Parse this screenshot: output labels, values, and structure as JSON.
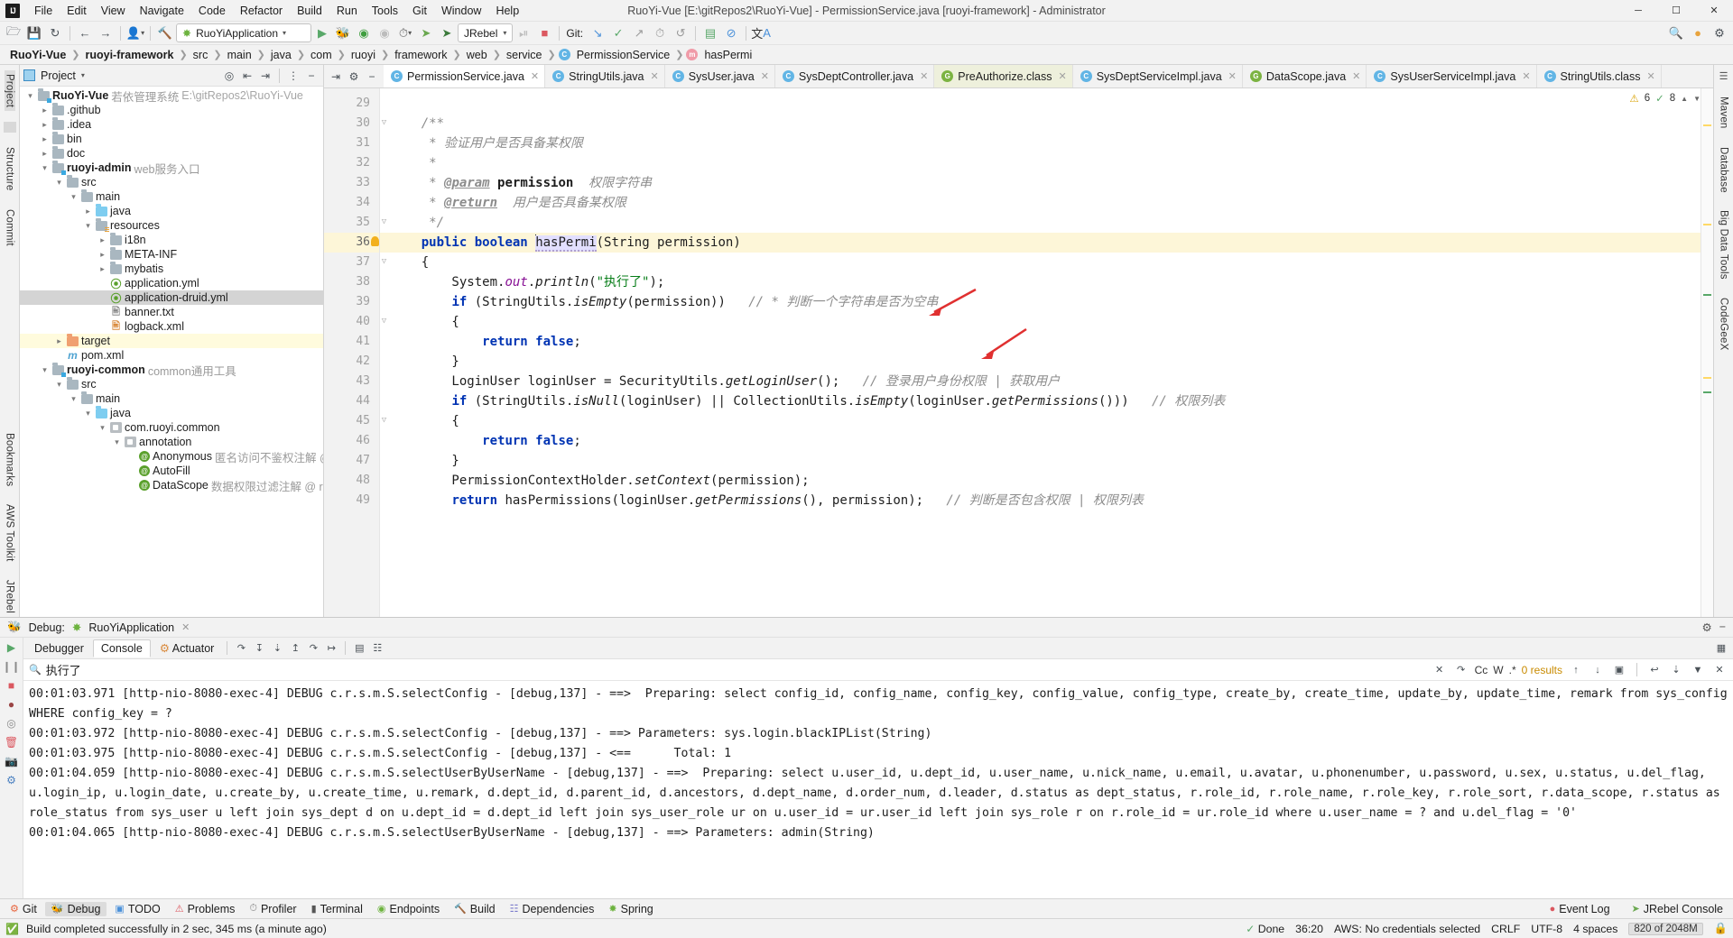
{
  "window": {
    "title": "RuoYi-Vue [E:\\gitRepos2\\RuoYi-Vue] - PermissionService.java [ruoyi-framework] - Administrator",
    "minimize": "─",
    "maximize": "☐",
    "close": "✕"
  },
  "menu": [
    "File",
    "Edit",
    "View",
    "Navigate",
    "Code",
    "Refactor",
    "Build",
    "Run",
    "Tools",
    "Git",
    "Window",
    "Help"
  ],
  "toolbar": {
    "open_icon": "folder-open-icon",
    "save_icon": "save-icon",
    "sync_icon": "sync-icon",
    "back_icon": "←",
    "forward_icon": "→",
    "profile_icon": "user-icon",
    "build_icon": "hammer-icon",
    "run_config": "RuoYiApplication",
    "run_icon": "▶",
    "debug_icon": "bug-icon",
    "run_coverage_icon": "coverage-icon",
    "rerun_icon": "rerun-icon",
    "profiler_icon": "profiler-icon",
    "jrebel_run_icon": "jrebel-run-icon",
    "jrebel_debug_icon": "jrebel-debug-icon",
    "jrebel_label": "JRebel",
    "stop_icon": "stop-icon",
    "git_label": "Git:",
    "git_update_icon": "update-project-icon",
    "git_commit_icon": "commit-icon",
    "git_push_icon": "push-icon",
    "git_history_icon": "history-icon",
    "git_rollback_icon": "rollback-icon",
    "monitor_icon": "monitor-icon",
    "noop_icon": "no-entry-icon",
    "translate_icon": "translate-icon",
    "search_icon": "search-icon",
    "plugin_icon": "plugin-icon",
    "settings_icon": "settings-icon"
  },
  "breadcrumb": [
    {
      "label": "RuoYi-Vue",
      "bold": true,
      "icon": null
    },
    {
      "label": "ruoyi-framework",
      "bold": true,
      "icon": null
    },
    {
      "label": "src",
      "bold": false,
      "icon": null
    },
    {
      "label": "main",
      "bold": false,
      "icon": null
    },
    {
      "label": "java",
      "bold": false,
      "icon": null
    },
    {
      "label": "com",
      "bold": false,
      "icon": null
    },
    {
      "label": "ruoyi",
      "bold": false,
      "icon": null
    },
    {
      "label": "framework",
      "bold": false,
      "icon": null
    },
    {
      "label": "web",
      "bold": false,
      "icon": null
    },
    {
      "label": "service",
      "bold": false,
      "icon": null
    },
    {
      "label": "PermissionService",
      "bold": false,
      "icon": "class"
    },
    {
      "label": "hasPermi",
      "bold": false,
      "icon": "method"
    }
  ],
  "left_rail": [
    "Project",
    "Structure",
    "Commit"
  ],
  "right_rail": [
    "Maven",
    "Database",
    "Big Data Tools",
    "CodeGeeX"
  ],
  "bottom_rail": [
    "Bookmarks",
    "AWS Toolkit",
    "JRebel"
  ],
  "project_panel": {
    "title": "Project",
    "select_icon": "target-icon",
    "expand_icon": "expand-all-icon",
    "collapse_icon": "collapse-all-icon",
    "settings_icon": "gear-icon",
    "hide_icon": "hide-icon",
    "tree": [
      {
        "indent": 0,
        "arrow": "v",
        "icon": "module",
        "name": "RuoYi-Vue",
        "bold": true,
        "desc": "若依管理系统",
        "path": "E:\\gitRepos2\\RuoYi-Vue",
        "state": ""
      },
      {
        "indent": 1,
        "arrow": ">",
        "icon": "folder",
        "name": ".github",
        "bold": false,
        "desc": "",
        "path": "",
        "state": ""
      },
      {
        "indent": 1,
        "arrow": ">",
        "icon": "folder",
        "name": ".idea",
        "bold": false,
        "desc": "",
        "path": "",
        "state": ""
      },
      {
        "indent": 1,
        "arrow": ">",
        "icon": "folder",
        "name": "bin",
        "bold": false,
        "desc": "",
        "path": "",
        "state": ""
      },
      {
        "indent": 1,
        "arrow": ">",
        "icon": "folder",
        "name": "doc",
        "bold": false,
        "desc": "",
        "path": "",
        "state": ""
      },
      {
        "indent": 1,
        "arrow": "v",
        "icon": "module",
        "name": "ruoyi-admin",
        "bold": true,
        "desc": "web服务入口",
        "path": "",
        "state": ""
      },
      {
        "indent": 2,
        "arrow": "v",
        "icon": "folder",
        "name": "src",
        "bold": false,
        "desc": "",
        "path": "",
        "state": ""
      },
      {
        "indent": 3,
        "arrow": "v",
        "icon": "folder",
        "name": "main",
        "bold": false,
        "desc": "",
        "path": "",
        "state": ""
      },
      {
        "indent": 4,
        "arrow": ">",
        "icon": "folder-blue",
        "name": "java",
        "bold": false,
        "desc": "",
        "path": "",
        "state": ""
      },
      {
        "indent": 4,
        "arrow": "v",
        "icon": "folder-res",
        "name": "resources",
        "bold": false,
        "desc": "",
        "path": "",
        "state": ""
      },
      {
        "indent": 5,
        "arrow": ">",
        "icon": "folder",
        "name": "i18n",
        "bold": false,
        "desc": "",
        "path": "",
        "state": ""
      },
      {
        "indent": 5,
        "arrow": ">",
        "icon": "folder",
        "name": "META-INF",
        "bold": false,
        "desc": "",
        "path": "",
        "state": ""
      },
      {
        "indent": 5,
        "arrow": ">",
        "icon": "folder",
        "name": "mybatis",
        "bold": false,
        "desc": "",
        "path": "",
        "state": ""
      },
      {
        "indent": 5,
        "arrow": "",
        "icon": "yml",
        "name": "application.yml",
        "bold": false,
        "desc": "",
        "path": "",
        "state": ""
      },
      {
        "indent": 5,
        "arrow": "",
        "icon": "yml",
        "name": "application-druid.yml",
        "bold": false,
        "desc": "",
        "path": "",
        "state": "sel"
      },
      {
        "indent": 5,
        "arrow": "",
        "icon": "txt",
        "name": "banner.txt",
        "bold": false,
        "desc": "",
        "path": "",
        "state": ""
      },
      {
        "indent": 5,
        "arrow": "",
        "icon": "xml",
        "name": "logback.xml",
        "bold": false,
        "desc": "",
        "path": "",
        "state": ""
      },
      {
        "indent": 2,
        "arrow": ">",
        "icon": "folder-orange",
        "name": "target",
        "bold": false,
        "desc": "",
        "path": "",
        "state": "hl"
      },
      {
        "indent": 2,
        "arrow": "",
        "icon": "maven",
        "name": "pom.xml",
        "bold": false,
        "desc": "",
        "path": "",
        "state": ""
      },
      {
        "indent": 1,
        "arrow": "v",
        "icon": "module",
        "name": "ruoyi-common",
        "bold": true,
        "desc": "common通用工具",
        "path": "",
        "state": ""
      },
      {
        "indent": 2,
        "arrow": "v",
        "icon": "folder",
        "name": "src",
        "bold": false,
        "desc": "",
        "path": "",
        "state": ""
      },
      {
        "indent": 3,
        "arrow": "v",
        "icon": "folder",
        "name": "main",
        "bold": false,
        "desc": "",
        "path": "",
        "state": ""
      },
      {
        "indent": 4,
        "arrow": "v",
        "icon": "folder-blue",
        "name": "java",
        "bold": false,
        "desc": "",
        "path": "",
        "state": ""
      },
      {
        "indent": 5,
        "arrow": "v",
        "icon": "package",
        "name": "com.ruoyi.common",
        "bold": false,
        "desc": "",
        "path": "",
        "state": ""
      },
      {
        "indent": 6,
        "arrow": "v",
        "icon": "package",
        "name": "annotation",
        "bold": false,
        "desc": "",
        "path": "",
        "state": ""
      },
      {
        "indent": 7,
        "arrow": "",
        "icon": "annotation",
        "name": "Anonymous",
        "bold": false,
        "desc": "匿名访问不鉴权注解 @ ruoyi",
        "path": "",
        "state": ""
      },
      {
        "indent": 7,
        "arrow": "",
        "icon": "annotation",
        "name": "AutoFill",
        "bold": false,
        "desc": "",
        "path": "",
        "state": ""
      },
      {
        "indent": 7,
        "arrow": "",
        "icon": "annotation",
        "name": "DataScope",
        "bold": false,
        "desc": "数据权限过滤注解 @ ruoyi",
        "path": "",
        "state": ""
      }
    ]
  },
  "editor": {
    "tools": {
      "collapse_icon": "collapse-icon",
      "settings_icon": "gear-icon",
      "hide_icon": "minus-icon"
    },
    "tabs": [
      {
        "label": "PermissionService.java",
        "icon": "class",
        "state": "active"
      },
      {
        "label": "StringUtils.java",
        "icon": "class",
        "state": ""
      },
      {
        "label": "SysUser.java",
        "icon": "class",
        "state": ""
      },
      {
        "label": "SysDeptController.java",
        "icon": "class",
        "state": ""
      },
      {
        "label": "PreAuthorize.class",
        "icon": "green",
        "state": "mod"
      },
      {
        "label": "SysDeptServiceImpl.java",
        "icon": "class",
        "state": ""
      },
      {
        "label": "DataScope.java",
        "icon": "green",
        "state": ""
      },
      {
        "label": "SysUserServiceImpl.java",
        "icon": "class",
        "state": ""
      },
      {
        "label": "StringUtils.class",
        "icon": "class",
        "state": ""
      }
    ],
    "inspection": {
      "warnings": "6",
      "errors": "8",
      "warn_icon": "warning-icon",
      "ok_icon": "checkmark-icon",
      "up_icon": "▲",
      "down_icon": "▼"
    },
    "first_line": 29,
    "current_line": 36,
    "lines": [
      {
        "n": 29,
        "fold": "",
        "text": ""
      },
      {
        "n": 30,
        "fold": "minus",
        "text": "    /**"
      },
      {
        "n": 31,
        "fold": "",
        "text": "     * 验证用户是否具备某权限"
      },
      {
        "n": 32,
        "fold": "",
        "text": "     *"
      },
      {
        "n": 33,
        "fold": "",
        "text": "     * @param permission 权限字符串"
      },
      {
        "n": 34,
        "fold": "",
        "text": "     * @return 用户是否具备某权限"
      },
      {
        "n": 35,
        "fold": "minus",
        "text": "     */"
      },
      {
        "n": 36,
        "fold": "",
        "text": "    public boolean hasPermi(String permission)"
      },
      {
        "n": 37,
        "fold": "minus",
        "text": "    {"
      },
      {
        "n": 38,
        "fold": "",
        "text": "        System.out.println(\"执行了\");"
      },
      {
        "n": 39,
        "fold": "",
        "text": "        if (StringUtils.isEmpty(permission))   // * 判断一个字符串是否为空串"
      },
      {
        "n": 40,
        "fold": "minus",
        "text": "        {"
      },
      {
        "n": 41,
        "fold": "",
        "text": "            return false;"
      },
      {
        "n": 42,
        "fold": "",
        "text": "        }"
      },
      {
        "n": 43,
        "fold": "",
        "text": "        LoginUser loginUser = SecurityUtils.getLoginUser();   // 登录用户身份权限 | 获取用户"
      },
      {
        "n": 44,
        "fold": "",
        "text": "        if (StringUtils.isNull(loginUser) || CollectionUtils.isEmpty(loginUser.getPermissions()))   // 权限列表"
      },
      {
        "n": 45,
        "fold": "minus",
        "text": "        {"
      },
      {
        "n": 46,
        "fold": "",
        "text": "            return false;"
      },
      {
        "n": 47,
        "fold": "",
        "text": "        }"
      },
      {
        "n": 48,
        "fold": "",
        "text": "        PermissionContextHolder.setContext(permission);"
      },
      {
        "n": 49,
        "fold": "",
        "text": "        return hasPermissions(loginUser.getPermissions(), permission);   // 判断是否包含权限 | 权限列表"
      }
    ]
  },
  "debug": {
    "label": "Debug:",
    "config": "RuoYiApplication",
    "close_icon": "close-icon",
    "settings_icon": "gear-icon",
    "hide_icon": "minus-icon",
    "tabs": [
      "Debugger",
      "Console",
      "Actuator"
    ],
    "active_tab": "Console",
    "actuator_icon": "actuator-icon",
    "rail_icons": [
      "resume-icon",
      "pause-icon",
      "stop-icon",
      "mute-breakpoints-icon",
      "view-breakpoints-icon",
      "settings-icon",
      "delete-icon",
      "camera-icon",
      "wrench-icon"
    ],
    "toolbar_icons": [
      "step-over-icon",
      "step-into-icon",
      "force-step-into-icon",
      "step-out-icon",
      "run-to-cursor-icon",
      "evaluate-icon",
      "frames-icon",
      "threads-icon"
    ],
    "search": {
      "value": "执行了",
      "prev_icon": "arrow-up-icon",
      "next_icon": "arrow-down-icon",
      "close_icon": "close-icon",
      "history_icon": "history-icon",
      "match_case": "Cc",
      "words": "W",
      "regex": ".*",
      "results": "0 results",
      "up_icon": "↑",
      "down_icon": "↓",
      "select_all_icon": "select-all-icon",
      "filter_icon": "filter-icon",
      "wrap_icon": "wrap-icon",
      "scroll_end_icon": "scroll-end-icon"
    },
    "console_lines": [
      "00:01:03.971 [http-nio-8080-exec-4] DEBUG c.r.s.m.S.selectConfig - [debug,137] - ==>  Preparing: select config_id, config_name, config_key, config_value, config_type, create_by, create_time, update_by, update_time, remark from sys_config WHERE config_key = ?",
      "00:01:03.972 [http-nio-8080-exec-4] DEBUG c.r.s.m.S.selectConfig - [debug,137] - ==> Parameters: sys.login.blackIPList(String)",
      "00:01:03.975 [http-nio-8080-exec-4] DEBUG c.r.s.m.S.selectConfig - [debug,137] - <==      Total: 1",
      "00:01:04.059 [http-nio-8080-exec-4] DEBUG c.r.s.m.S.selectUserByUserName - [debug,137] - ==>  Preparing: select u.user_id, u.dept_id, u.user_name, u.nick_name, u.email, u.avatar, u.phonenumber, u.password, u.sex, u.status, u.del_flag, u.login_ip, u.login_date, u.create_by, u.create_time, u.remark, d.dept_id, d.parent_id, d.ancestors, d.dept_name, d.order_num, d.leader, d.status as dept_status, r.role_id, r.role_name, r.role_key, r.role_sort, r.data_scope, r.status as role_status from sys_user u left join sys_dept d on u.dept_id = d.dept_id left join sys_user_role ur on u.user_id = ur.user_id left join sys_role r on r.role_id = ur.role_id where u.user_name = ? and u.del_flag = '0'",
      "00:01:04.065 [http-nio-8080-exec-4] DEBUG c.r.s.m.S.selectUserByUserName - [debug,137] - ==> Parameters: admin(String)"
    ]
  },
  "toolwindow_bar": {
    "left": [
      {
        "label": "Git",
        "icon": "git-icon",
        "active": false
      },
      {
        "label": "Debug",
        "icon": "debug-icon",
        "active": true
      },
      {
        "label": "TODO",
        "icon": "todo-icon",
        "active": false
      },
      {
        "label": "Problems",
        "icon": "problems-icon",
        "active": false
      },
      {
        "label": "Profiler",
        "icon": "profiler-icon",
        "active": false
      },
      {
        "label": "Terminal",
        "icon": "terminal-icon",
        "active": false
      },
      {
        "label": "Endpoints",
        "icon": "endpoints-icon",
        "active": false
      },
      {
        "label": "Build",
        "icon": "build-icon",
        "active": false
      },
      {
        "label": "Dependencies",
        "icon": "dependencies-icon",
        "active": false
      },
      {
        "label": "Spring",
        "icon": "spring-icon",
        "active": false
      }
    ],
    "right": [
      {
        "label": "Event Log",
        "icon": "event-log-icon"
      },
      {
        "label": "JRebel Console",
        "icon": "jrebel-icon"
      }
    ]
  },
  "status_bar": {
    "build_icon": "build-success-icon",
    "message": "Build completed successfully in 2 sec, 345 ms (a minute ago)",
    "done_icon": "done-icon",
    "done": "Done",
    "position": "36:20",
    "aws": "AWS: No credentials selected",
    "line_sep": "CRLF",
    "encoding": "UTF-8",
    "indent": "4 spaces",
    "memory": "820 of 2048M",
    "lock_icon": "lock-icon"
  }
}
